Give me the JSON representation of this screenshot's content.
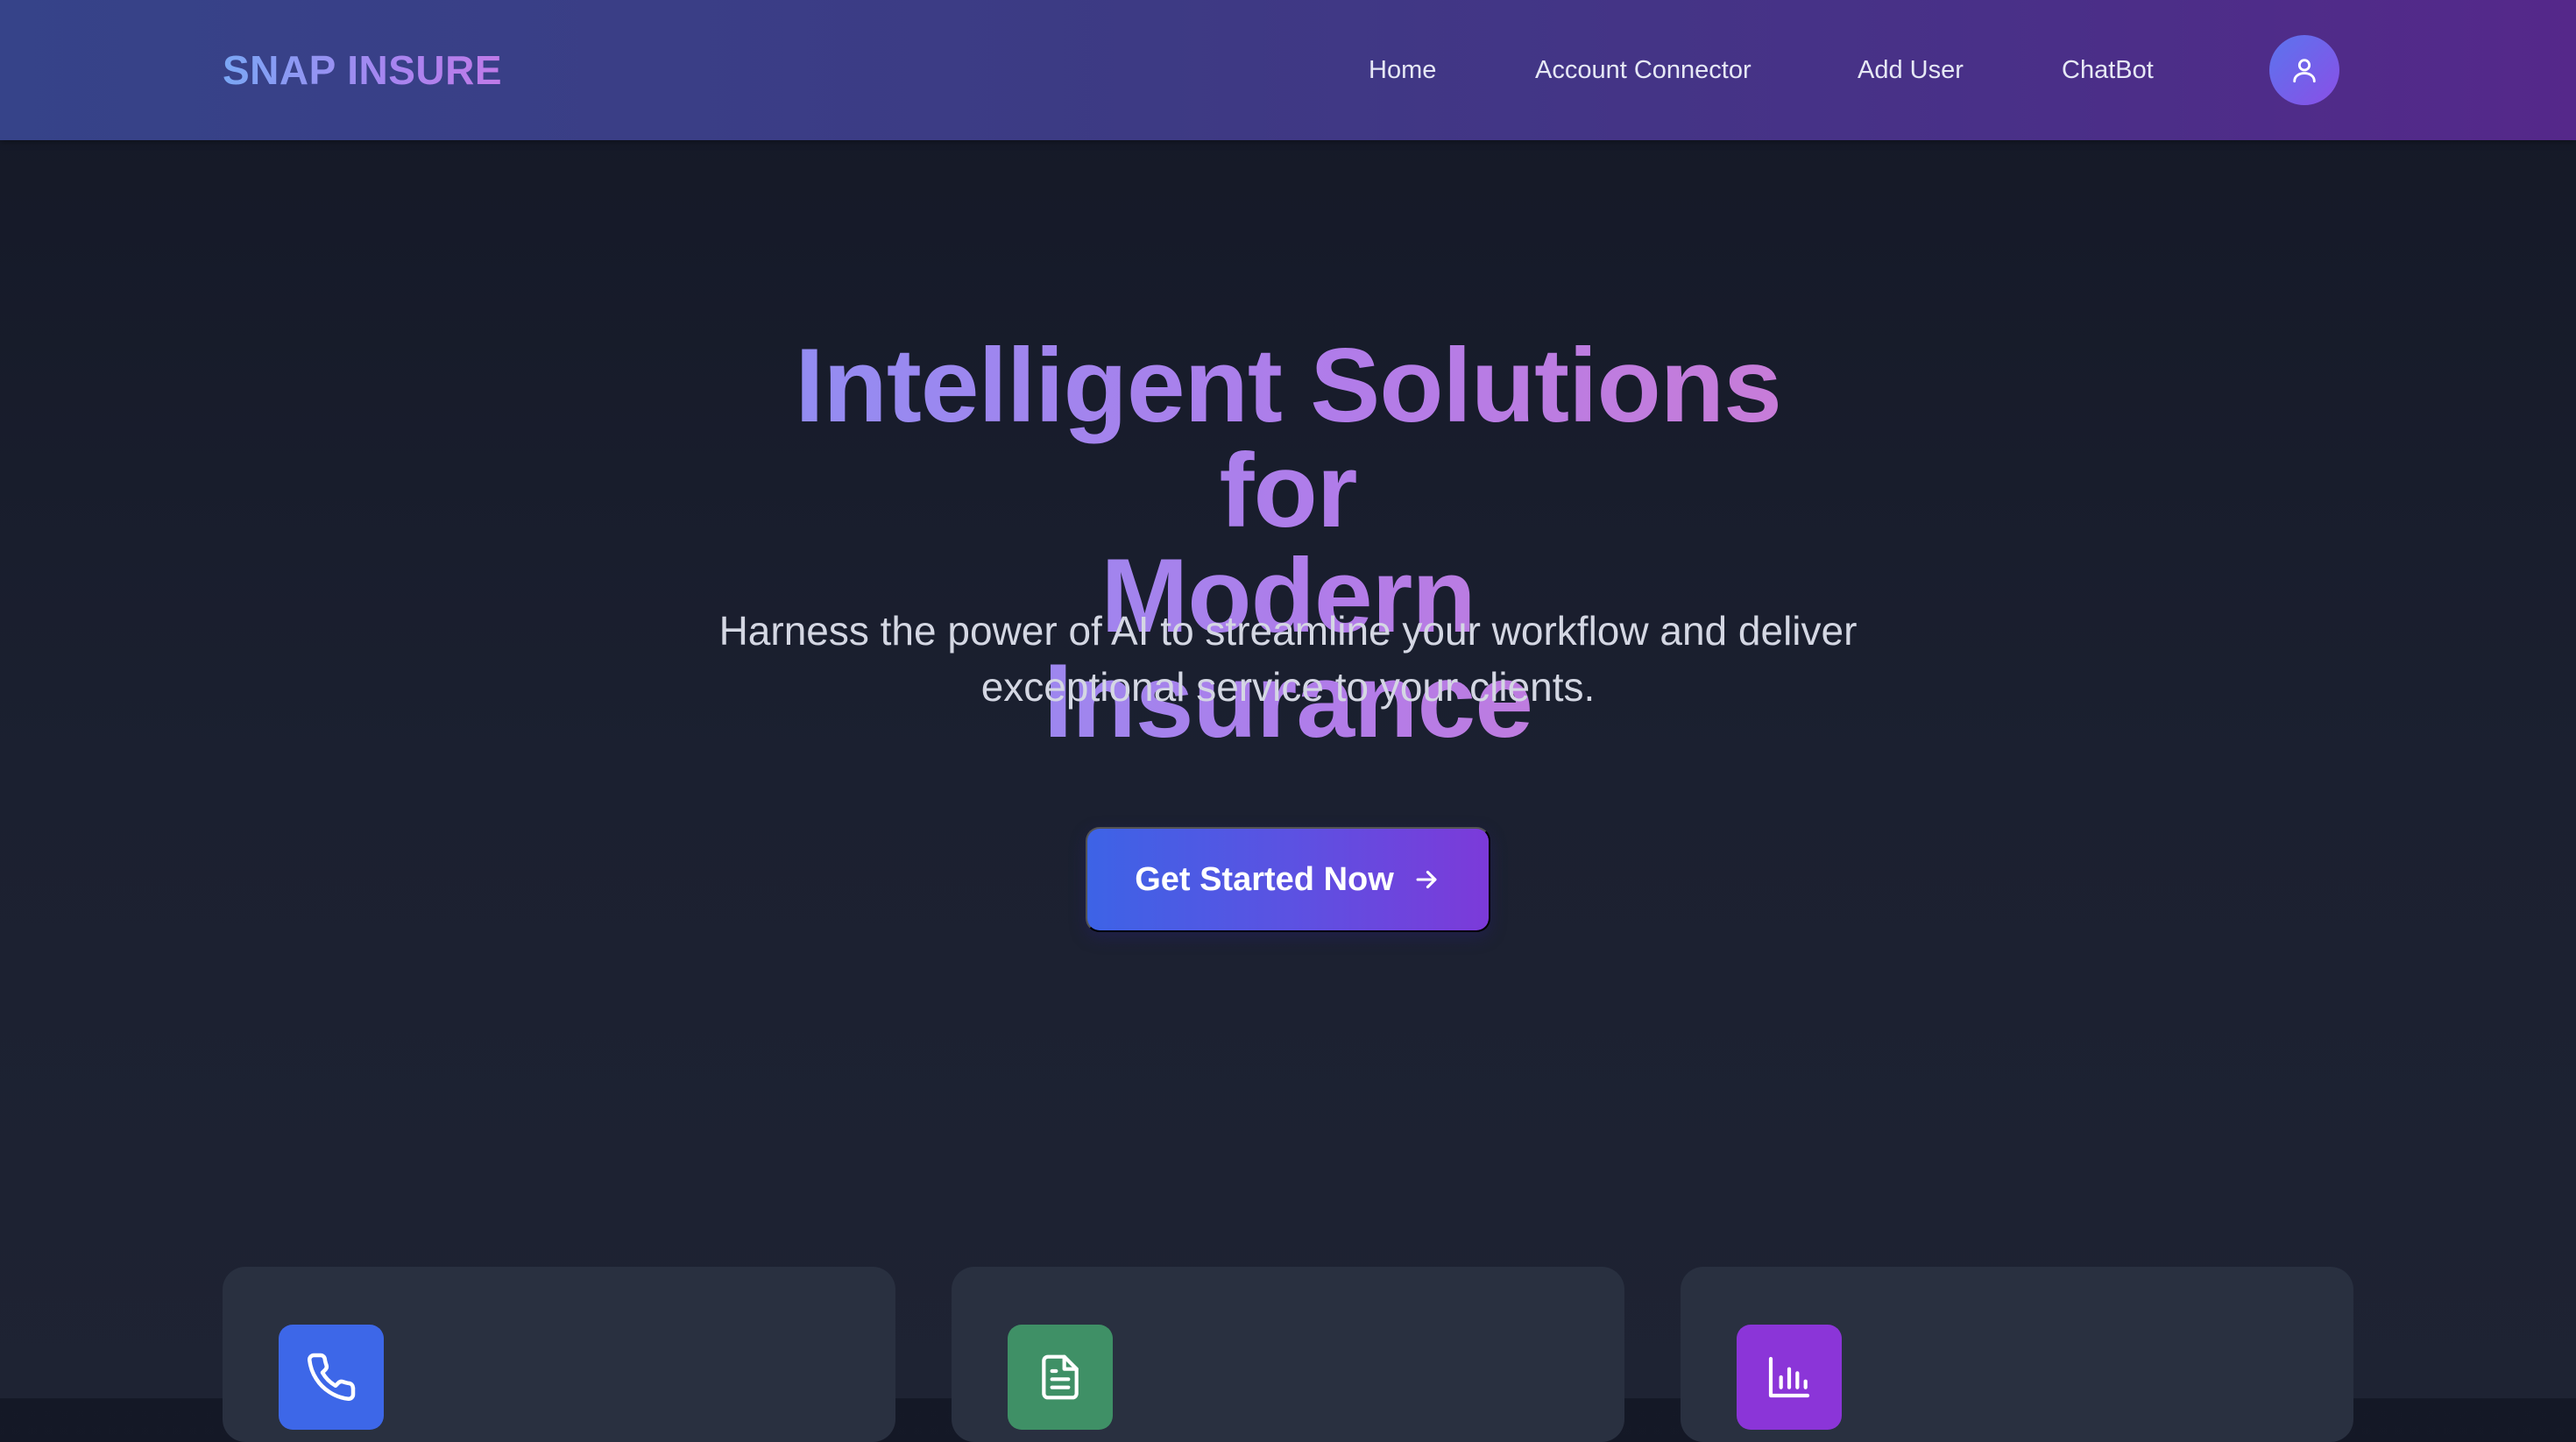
{
  "app": {
    "brand": "SNAP INSURE"
  },
  "nav": {
    "items": [
      {
        "label": "Home"
      },
      {
        "label": "Account Connector"
      },
      {
        "label": "Add User"
      },
      {
        "label": "ChatBot"
      }
    ],
    "profile_icon": "user-icon"
  },
  "hero": {
    "title_line1": "Intelligent Solutions for",
    "title_line2": "Modern Insurance",
    "subtitle": "Harness the power of AI to streamline your workflow and deliver exceptional service to your clients.",
    "cta_label": "Get Started Now",
    "cta_icon": "arrow-right-icon"
  },
  "features": [
    {
      "icon": "phone-icon",
      "icon_color": "#3d67e8"
    },
    {
      "icon": "document-icon",
      "icon_color": "#3f9066"
    },
    {
      "icon": "bar-chart-icon",
      "icon_color": "#8b35d8"
    }
  ],
  "colors": {
    "accent_blue": "#3d63e6",
    "accent_purple": "#7c3ad9",
    "background": "#1b2030",
    "card": "#293040"
  }
}
